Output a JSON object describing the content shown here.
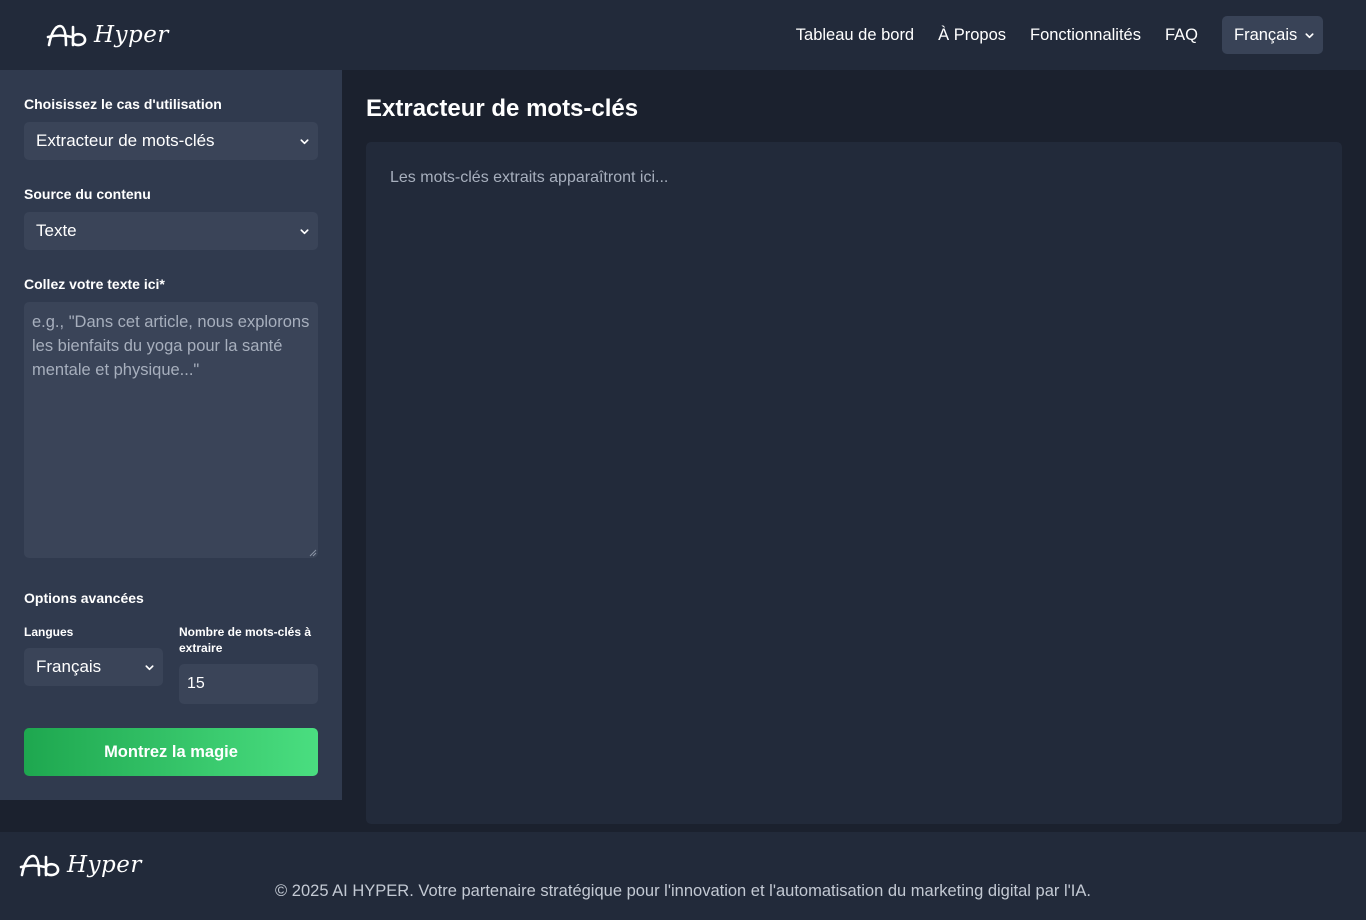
{
  "header": {
    "logo_text": "Hyper",
    "nav": [
      "Tableau de bord",
      "À Propos",
      "Fonctionnalités",
      "FAQ"
    ],
    "language": "Français"
  },
  "sidebar": {
    "use_case_label": "Choisissez le cas d'utilisation",
    "use_case_value": "Extracteur de mots-clés",
    "source_label": "Source du contenu",
    "source_value": "Texte",
    "text_label": "Collez votre texte ici*",
    "text_placeholder": "e.g., \"Dans cet article, nous explorons les bienfaits du yoga pour la santé mentale et physique...\"",
    "advanced_label": "Options avancées",
    "languages_label": "Langues",
    "languages_value": "Français",
    "count_label": "Nombre de mots-clés à extraire",
    "count_value": "15",
    "submit_label": "Montrez la magie"
  },
  "main": {
    "title": "Extracteur de mots-clés",
    "output_placeholder": "Les mots-clés extraits apparaîtront ici..."
  },
  "footer": {
    "logo_text": "Hyper",
    "copyright": "© 2025 AI HYPER. Votre partenaire stratégique pour l'innovation et l'automatisation du marketing digital par l'IA."
  },
  "colors": {
    "accent_start": "#1ea74f",
    "accent_end": "#4ade80"
  }
}
